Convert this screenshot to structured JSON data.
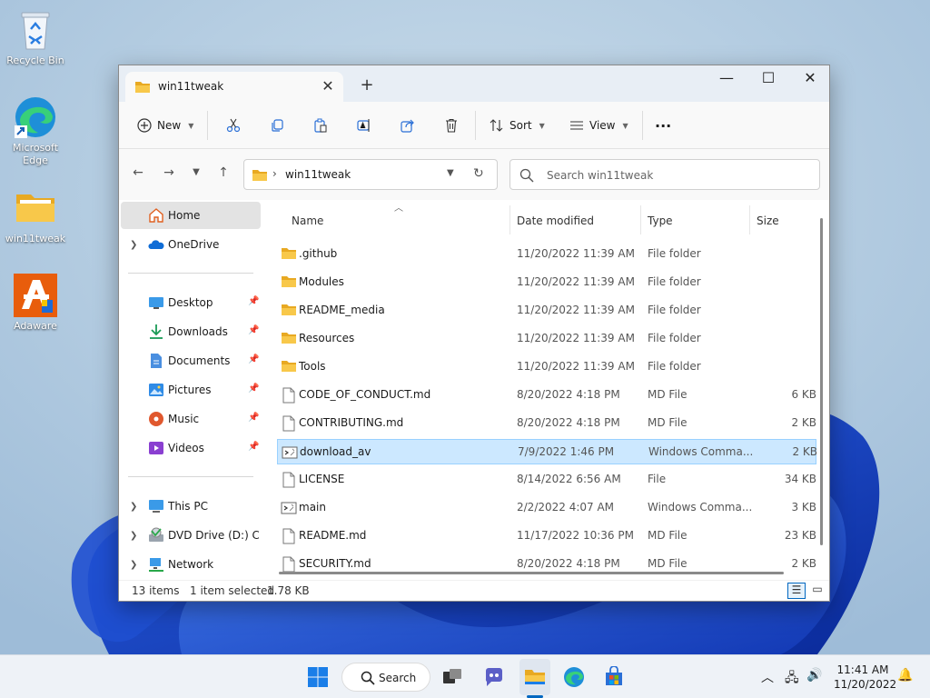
{
  "desktop": {
    "icons": [
      {
        "label": "Recycle Bin"
      },
      {
        "label": "Microsoft Edge"
      },
      {
        "label": "win11tweak"
      },
      {
        "label": "Adaware"
      }
    ]
  },
  "window": {
    "tab_title": "win11tweak",
    "toolbar": {
      "new_label": "New",
      "sort_label": "Sort",
      "view_label": "View",
      "more_label": "···"
    },
    "address": {
      "path": "win11tweak",
      "search_placeholder": "Search win11tweak"
    },
    "sidebar": {
      "top": [
        {
          "label": "Home"
        },
        {
          "label": "OneDrive"
        }
      ],
      "quick": [
        {
          "label": "Desktop"
        },
        {
          "label": "Downloads"
        },
        {
          "label": "Documents"
        },
        {
          "label": "Pictures"
        },
        {
          "label": "Music"
        },
        {
          "label": "Videos"
        }
      ],
      "bottom": [
        {
          "label": "This PC"
        },
        {
          "label": "DVD Drive (D:) CCSA"
        },
        {
          "label": "Network"
        }
      ]
    },
    "columns": {
      "name": "Name",
      "date": "Date modified",
      "type": "Type",
      "size": "Size"
    },
    "files": [
      {
        "name": ".github",
        "date": "11/20/2022 11:39 AM",
        "type": "File folder",
        "size": ""
      },
      {
        "name": "Modules",
        "date": "11/20/2022 11:39 AM",
        "type": "File folder",
        "size": ""
      },
      {
        "name": "README_media",
        "date": "11/20/2022 11:39 AM",
        "type": "File folder",
        "size": ""
      },
      {
        "name": "Resources",
        "date": "11/20/2022 11:39 AM",
        "type": "File folder",
        "size": ""
      },
      {
        "name": "Tools",
        "date": "11/20/2022 11:39 AM",
        "type": "File folder",
        "size": ""
      },
      {
        "name": "CODE_OF_CONDUCT.md",
        "date": "8/20/2022 4:18 PM",
        "type": "MD File",
        "size": "6 KB"
      },
      {
        "name": "CONTRIBUTING.md",
        "date": "8/20/2022 4:18 PM",
        "type": "MD File",
        "size": "2 KB"
      },
      {
        "name": "download_av",
        "date": "7/9/2022 1:46 PM",
        "type": "Windows Comma...",
        "size": "2 KB"
      },
      {
        "name": "LICENSE",
        "date": "8/14/2022 6:56 AM",
        "type": "File",
        "size": "34 KB"
      },
      {
        "name": "main",
        "date": "2/2/2022 4:07 AM",
        "type": "Windows Comma...",
        "size": "3 KB"
      },
      {
        "name": "README.md",
        "date": "11/17/2022 10:36 PM",
        "type": "MD File",
        "size": "23 KB"
      },
      {
        "name": "SECURITY.md",
        "date": "8/20/2022 4:18 PM",
        "type": "MD File",
        "size": "2 KB"
      }
    ],
    "status": {
      "count": "13 items",
      "selected": "1 item selected",
      "size": "1.78 KB"
    }
  },
  "taskbar": {
    "search_label": "Search",
    "time": "11:41 AM",
    "date": "11/20/2022"
  },
  "colors": {
    "folder": "#f5c242",
    "selection": "#cce8ff",
    "accent": "#0067c0"
  }
}
